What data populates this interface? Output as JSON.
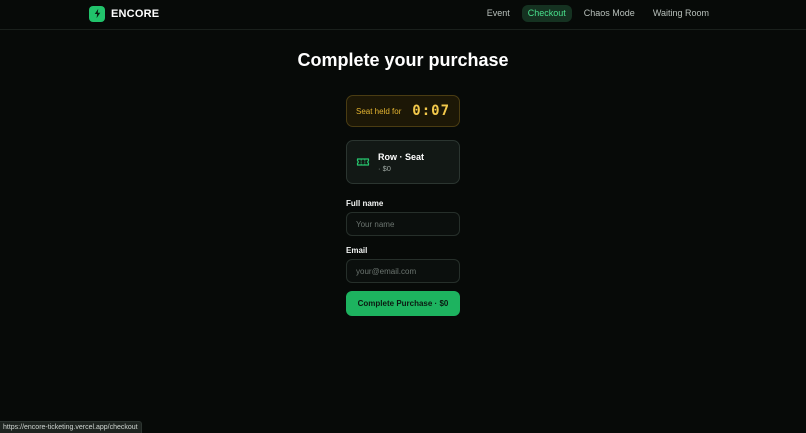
{
  "header": {
    "brand": "ENCORE",
    "nav": [
      {
        "label": "Event",
        "active": false
      },
      {
        "label": "Checkout",
        "active": true
      },
      {
        "label": "Chaos Mode",
        "active": false
      },
      {
        "label": "Waiting Room",
        "active": false
      }
    ]
  },
  "main": {
    "title": "Complete your purchase",
    "timer": {
      "label": "Seat held for",
      "value": "0:07"
    },
    "seat": {
      "title": "Row · Seat",
      "price": "· $0",
      "icon": "ticket-icon"
    },
    "form": {
      "full_name": {
        "label": "Full name",
        "placeholder": "Your name",
        "value": ""
      },
      "email": {
        "label": "Email",
        "placeholder": "your@email.com",
        "value": ""
      },
      "submit_label": "Complete Purchase · $0"
    }
  },
  "status_bar": {
    "url": "https://encore-ticketing.vercel.app/checkout"
  },
  "colors": {
    "background": "#070a08",
    "accent": "#21c36b",
    "timer": "#f2c84b"
  }
}
